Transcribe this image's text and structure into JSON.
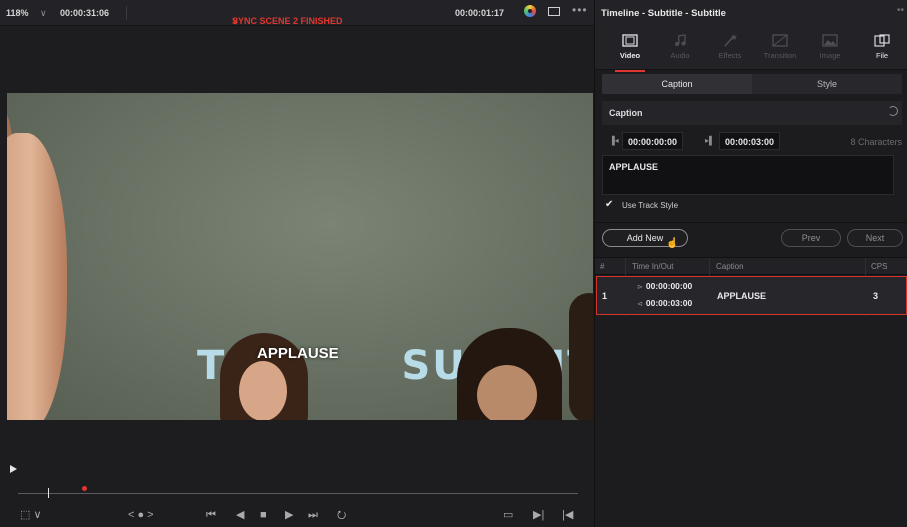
{
  "viewer": {
    "zoom": "118%",
    "zoom_chevron": "chevron-down-icon",
    "source_timecode": "00:00:31:06",
    "timeline_name": "SYNC SCENE 2 FINISHED",
    "timeline_chevron": "∨",
    "record_timecode": "00:00:01:17",
    "more_icon": "•••",
    "overlay_caption": "APPLAUSE",
    "background_banner": "T           SUMMIT 2",
    "controls": {
      "transform": "⬚ ∨",
      "nudge": "< ● >",
      "first": "⏮",
      "reverse": "◀",
      "stop": "■",
      "play": "▶",
      "last": "⏭",
      "loop": "⭮",
      "match_frame": "▭",
      "next_clip": "▶|",
      "prev_clip": "|◀"
    }
  },
  "inspector": {
    "title": "Timeline - Subtitle - Subtitle",
    "more_icon": "••",
    "tabs": [
      {
        "label": "Video",
        "icon": "film-icon",
        "state": "active"
      },
      {
        "label": "Audio",
        "icon": "music-note-icon",
        "state": "disabled"
      },
      {
        "label": "Effects",
        "icon": "magic-wand-icon",
        "state": "disabled"
      },
      {
        "label": "Transition",
        "icon": "transition-icon",
        "state": "disabled"
      },
      {
        "label": "Image",
        "icon": "image-icon",
        "state": "disabled"
      },
      {
        "label": "File",
        "icon": "file-icon",
        "state": "enabled"
      }
    ],
    "sub_tabs": [
      {
        "label": "Caption",
        "active": true
      },
      {
        "label": "Style",
        "active": false
      }
    ],
    "caption_section": {
      "title": "Caption",
      "in_icon": "▐◂",
      "in_timecode": "00:00:00:00",
      "out_icon": "▸▌",
      "out_timecode": "00:00:03:00",
      "character_count": "8 Characters",
      "text": "APPLAUSE",
      "use_track_style_label": "Use Track Style",
      "use_track_style_checked": true
    },
    "buttons": {
      "add_new": "Add New",
      "prev": "Prev",
      "next": "Next"
    },
    "table": {
      "headers": [
        "#",
        "Time In/Out",
        "Caption",
        "CPS"
      ],
      "rows": [
        {
          "index": "1",
          "time_in": "00:00:00:00",
          "time_out": "00:00:03:00",
          "caption": "APPLAUSE",
          "cps": "3"
        }
      ]
    }
  },
  "colors": {
    "accent_red": "#e0362f",
    "panel_bg": "#1c1c1f",
    "header_bg": "#232327"
  }
}
